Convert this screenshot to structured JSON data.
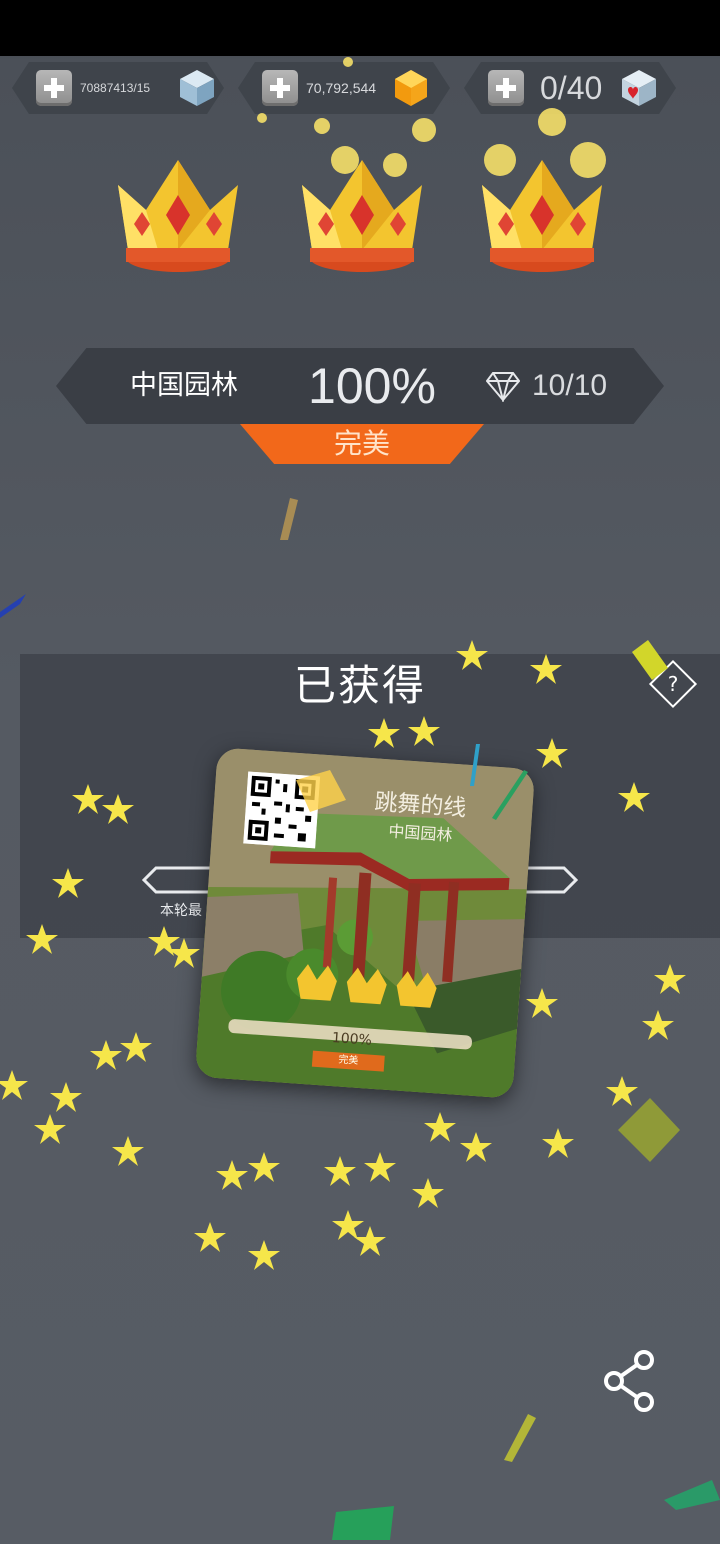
{
  "header": {
    "resources": [
      {
        "name": "blue-cube",
        "value": "70887413/15",
        "icon": "ice-cube-icon"
      },
      {
        "name": "gold-gem",
        "value": "70,792,544",
        "icon": "gold-gem-icon"
      },
      {
        "name": "mystery-box",
        "value": "0/40",
        "icon": "heart-box-icon"
      }
    ]
  },
  "result": {
    "crowns_earned": 3,
    "level_name": "中国园林",
    "percent": "100%",
    "gems": "10/10",
    "rating": "完美"
  },
  "reward": {
    "heading": "已获得",
    "help": "?",
    "best_label": "本轮最",
    "card": {
      "game_title": "跳舞的线",
      "level_name": "中国园林",
      "percent": "100%",
      "rating": "完美"
    }
  },
  "colors": {
    "accent_orange": "#f2681a",
    "crown_gold": "#f4c430",
    "banner_bg": "#3a3e45"
  }
}
